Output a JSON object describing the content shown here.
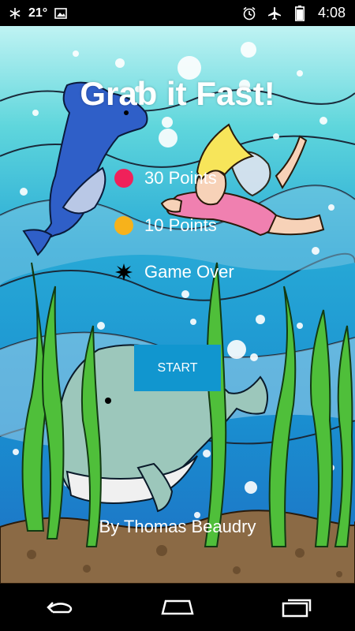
{
  "status_bar": {
    "temperature": "21°",
    "time": "4:08",
    "icons": [
      "snowflake-icon",
      "image-icon",
      "alarm-icon",
      "airplane-mode-icon",
      "battery-icon"
    ]
  },
  "game": {
    "title": "Grab it Fast!",
    "legend": [
      {
        "label": "30 Points",
        "color": "#f0215a",
        "icon": "red-ball-icon"
      },
      {
        "label": "10 Points",
        "color": "#f7b21b",
        "icon": "yellow-ball-icon"
      },
      {
        "label": "Game Over",
        "color": "#000000",
        "icon": "bomb-icon"
      }
    ],
    "start_label": "START",
    "credit": "By Thomas Beaudry",
    "accent_color": "#1196cf"
  },
  "nav_bar": {
    "buttons": [
      "back-icon",
      "home-icon",
      "recent-apps-icon"
    ]
  }
}
